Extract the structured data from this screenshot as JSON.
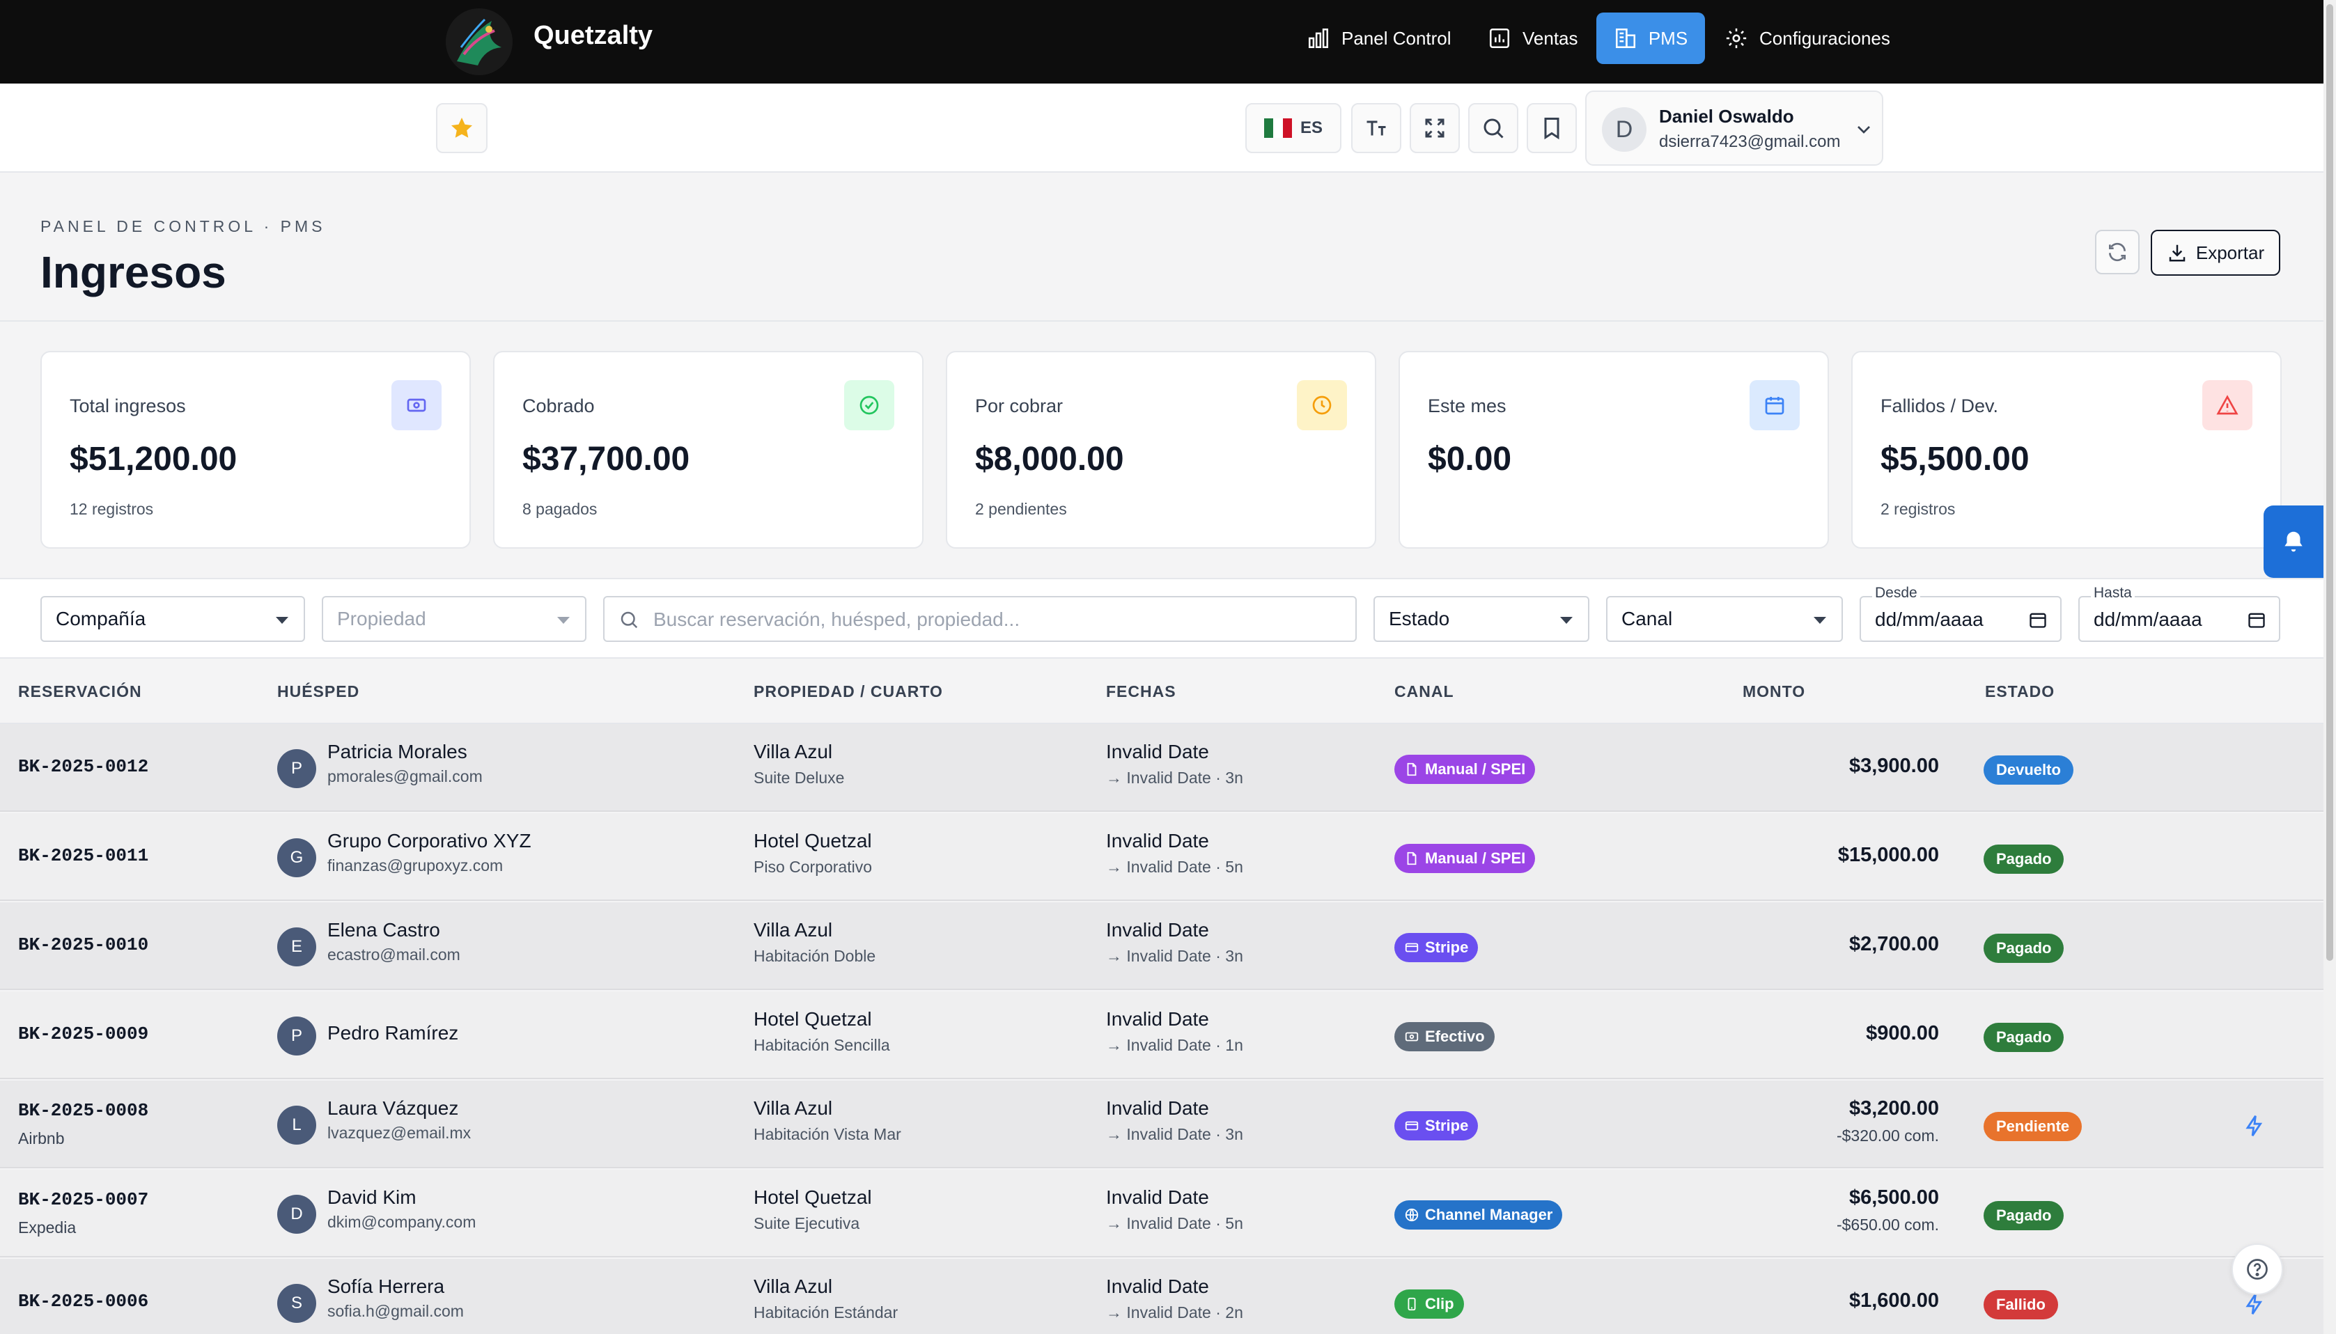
{
  "nav": {
    "brand": "Quetzalty",
    "items": [
      {
        "label": "Panel Control",
        "icon": "bar-chart-icon"
      },
      {
        "label": "Ventas",
        "icon": "bar-chart-square-icon"
      },
      {
        "label": "PMS",
        "icon": "building-icon",
        "active": true
      },
      {
        "label": "Configuraciones",
        "icon": "gear-icon"
      }
    ]
  },
  "toolbar": {
    "language": "ES"
  },
  "user": {
    "initial": "D",
    "name": "Daniel Oswaldo",
    "email": "dsierra7423@gmail.com"
  },
  "header": {
    "breadcrumb": "PANEL DE CONTROL · PMS",
    "title": "Ingresos",
    "export_label": "Exportar"
  },
  "stats": [
    {
      "label": "Total ingresos",
      "value": "$51,200.00",
      "sub": "12 registros",
      "icon": "money-icon",
      "color": "#6366f1",
      "bg": "#e0e7ff"
    },
    {
      "label": "Cobrado",
      "value": "$37,700.00",
      "sub": "8 pagados",
      "icon": "check-circle-icon",
      "color": "#22c55e",
      "bg": "#dcfce7"
    },
    {
      "label": "Por cobrar",
      "value": "$8,000.00",
      "sub": "2 pendientes",
      "icon": "clock-icon",
      "color": "#f59e0b",
      "bg": "#fef3c7"
    },
    {
      "label": "Este mes",
      "value": "$0.00",
      "sub": "",
      "icon": "calendar-icon",
      "color": "#3b82f6",
      "bg": "#dbeafe"
    },
    {
      "label": "Fallidos / Dev.",
      "value": "$5,500.00",
      "sub": "2 registros",
      "icon": "warning-icon",
      "color": "#ef4444",
      "bg": "#fee2e2"
    }
  ],
  "filters": {
    "company": "Compañía",
    "property": "Propiedad",
    "search_placeholder": "Buscar reservación, huésped, propiedad...",
    "status": "Estado",
    "channel": "Canal",
    "from_label": "Desde",
    "from_value": "dd/mm/aaaa",
    "to_label": "Hasta",
    "to_value": "dd/mm/aaaa"
  },
  "table": {
    "headers": [
      "RESERVACIÓN",
      "HUÉSPED",
      "PROPIEDAD / CUARTO",
      "FECHAS",
      "CANAL",
      "MONTO",
      "ESTADO"
    ],
    "rows": [
      {
        "id": "BK-2025-0012",
        "source": "",
        "initial": "P",
        "guest": "Patricia Morales",
        "email": "pmorales@gmail.com",
        "property": "Villa Azul",
        "room": "Suite Deluxe",
        "date": "Invalid Date",
        "date_sub": "→ Invalid Date · 3n",
        "channel": "Manual / SPEI",
        "channel_icon": "document-icon",
        "channel_color": "#9b45e6",
        "amount": "$3,900.00",
        "fee": "",
        "status": "Devuelto",
        "status_color": "#2b7fd6",
        "action": false
      },
      {
        "id": "BK-2025-0011",
        "source": "",
        "initial": "G",
        "guest": "Grupo Corporativo XYZ",
        "email": "finanzas@grupoxyz.com",
        "property": "Hotel Quetzal",
        "room": "Piso Corporativo",
        "date": "Invalid Date",
        "date_sub": "→ Invalid Date · 5n",
        "channel": "Manual / SPEI",
        "channel_icon": "document-icon",
        "channel_color": "#9b45e6",
        "amount": "$15,000.00",
        "fee": "",
        "status": "Pagado",
        "status_color": "#2e7d3c",
        "action": false
      },
      {
        "id": "BK-2025-0010",
        "source": "",
        "initial": "E",
        "guest": "Elena Castro",
        "email": "ecastro@mail.com",
        "property": "Villa Azul",
        "room": "Habitación Doble",
        "date": "Invalid Date",
        "date_sub": "→ Invalid Date · 3n",
        "channel": "Stripe",
        "channel_icon": "card-icon",
        "channel_color": "#6a4ff0",
        "amount": "$2,700.00",
        "fee": "",
        "status": "Pagado",
        "status_color": "#2e7d3c",
        "action": false
      },
      {
        "id": "BK-2025-0009",
        "source": "",
        "initial": "P",
        "guest": "Pedro Ramírez",
        "email": "",
        "property": "Hotel Quetzal",
        "room": "Habitación Sencilla",
        "date": "Invalid Date",
        "date_sub": "→ Invalid Date · 1n",
        "channel": "Efectivo",
        "channel_icon": "cash-icon",
        "channel_color": "#5f6b7a",
        "amount": "$900.00",
        "fee": "",
        "status": "Pagado",
        "status_color": "#2e7d3c",
        "action": false
      },
      {
        "id": "BK-2025-0008",
        "source": "Airbnb",
        "initial": "L",
        "guest": "Laura Vázquez",
        "email": "lvazquez@email.mx",
        "property": "Villa Azul",
        "room": "Habitación Vista Mar",
        "date": "Invalid Date",
        "date_sub": "→ Invalid Date · 3n",
        "channel": "Stripe",
        "channel_icon": "card-icon",
        "channel_color": "#6a4ff0",
        "amount": "$3,200.00",
        "fee": "-$320.00 com.",
        "status": "Pendiente",
        "status_color": "#e8732c",
        "action": true
      },
      {
        "id": "BK-2025-0007",
        "source": "Expedia",
        "initial": "D",
        "guest": "David Kim",
        "email": "dkim@company.com",
        "property": "Hotel Quetzal",
        "room": "Suite Ejecutiva",
        "date": "Invalid Date",
        "date_sub": "→ Invalid Date · 5n",
        "channel": "Channel Manager",
        "channel_icon": "globe-icon",
        "channel_color": "#2573c9",
        "amount": "$6,500.00",
        "fee": "-$650.00 com.",
        "status": "Pagado",
        "status_color": "#2e7d3c",
        "action": false
      },
      {
        "id": "BK-2025-0006",
        "source": "",
        "initial": "S",
        "guest": "Sofía Herrera",
        "email": "sofia.h@gmail.com",
        "property": "Villa Azul",
        "room": "Habitación Estándar",
        "date": "Invalid Date",
        "date_sub": "→ Invalid Date · 2n",
        "channel": "Clip",
        "channel_icon": "phone-icon",
        "channel_color": "#2fa64a",
        "amount": "$1,600.00",
        "fee": "",
        "status": "Fallido",
        "status_color": "#d33a3a",
        "action": true
      }
    ]
  }
}
